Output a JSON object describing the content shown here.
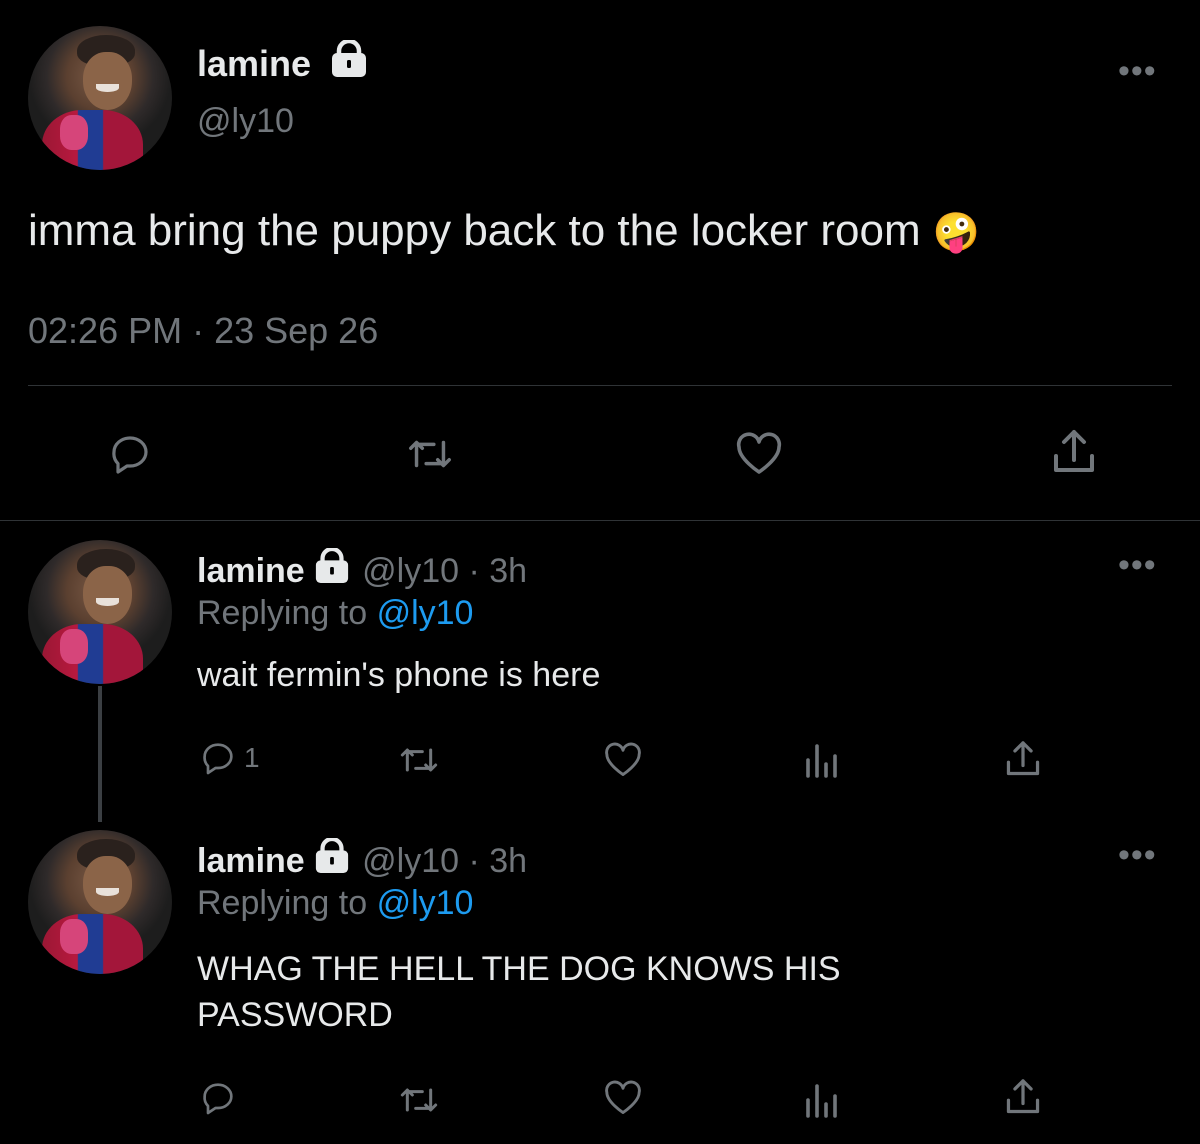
{
  "main_tweet": {
    "display_name": "lamine",
    "handle": "@ly10",
    "text": "imma bring the puppy back to the locker room",
    "emoji": "🤪",
    "timestamp": "02:26 PM · 23 Sep 26"
  },
  "replies": [
    {
      "display_name": "lamine",
      "handle_time": "@ly10 · 3h",
      "replying_label": "Replying to",
      "replying_to": "@ly10",
      "text": "wait fermin's phone is here",
      "reply_count": "1"
    },
    {
      "display_name": "lamine",
      "handle_time": "@ly10 · 3h",
      "replying_label": "Replying to",
      "replying_to": "@ly10",
      "text": "WHAG THE HELL THE DOG KNOWS HIS PASSWORD",
      "reply_count": ""
    }
  ],
  "icons": {
    "more": "more-icon",
    "reply": "reply-icon",
    "retweet": "retweet-icon",
    "like": "heart-icon",
    "views": "analytics-icon",
    "share": "share-icon",
    "lock": "lock-icon"
  },
  "colors": {
    "background": "#000000",
    "text": "#e7e9ea",
    "muted": "#71767b",
    "accent": "#1d9bf0"
  }
}
